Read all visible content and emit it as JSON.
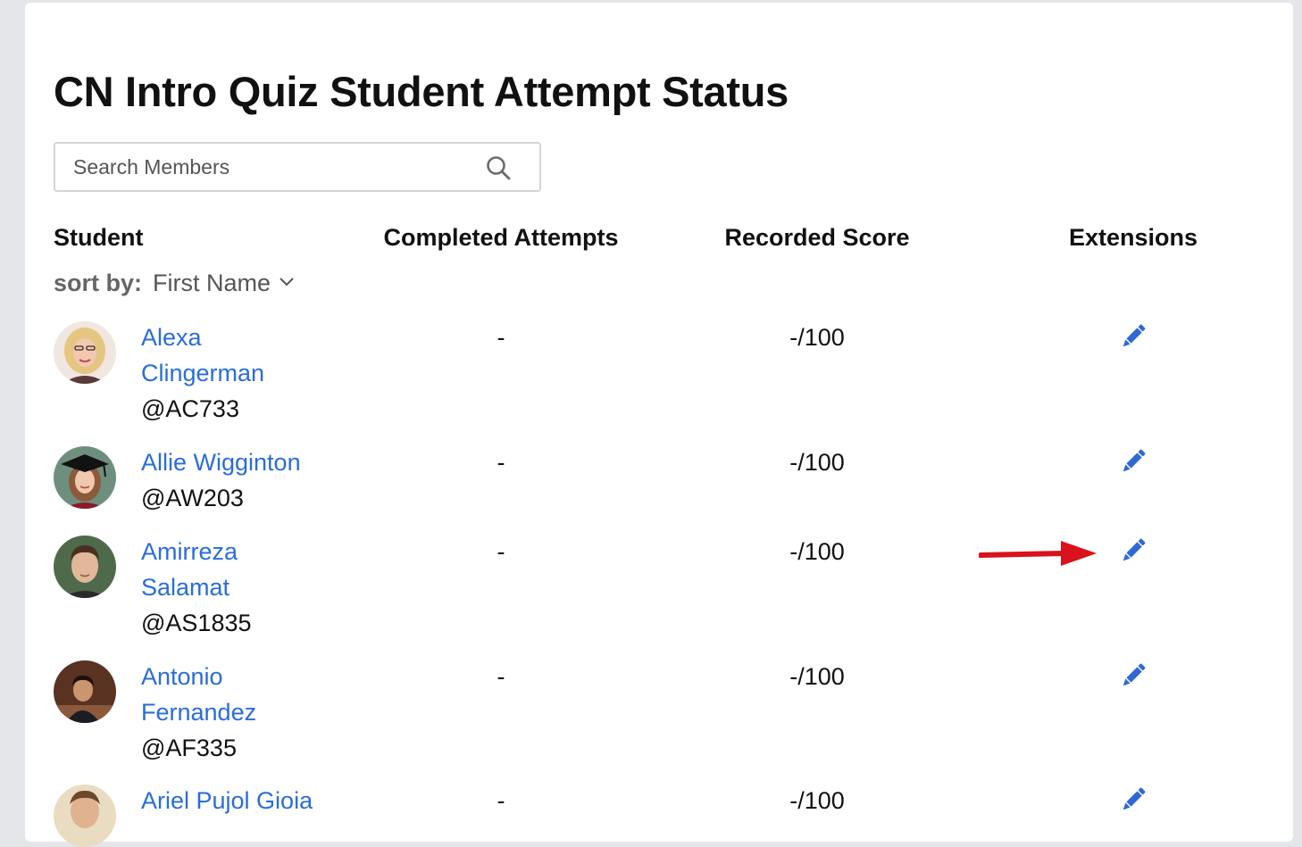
{
  "page": {
    "title": "CN Intro Quiz Student Attempt Status"
  },
  "search": {
    "placeholder": "Search Members",
    "icon": "search-icon"
  },
  "table": {
    "headers": {
      "student": "Student",
      "attempts": "Completed Attempts",
      "score": "Recorded Score",
      "extensions": "Extensions"
    },
    "sort": {
      "label": "sort by:",
      "value": "First Name"
    },
    "rows": [
      {
        "name": "Alexa Clingerman",
        "username": "@AC733",
        "attempts": "-",
        "score": "-/100"
      },
      {
        "name": "Allie Wigginton",
        "username": "@AW203",
        "attempts": "-",
        "score": "-/100"
      },
      {
        "name": "Amirreza Salamat",
        "username": "@AS1835",
        "attempts": "-",
        "score": "-/100"
      },
      {
        "name": "Antonio Fernandez",
        "username": "@AF335",
        "attempts": "-",
        "score": "-/100"
      },
      {
        "name": "Ariel Pujol Gioia",
        "username": "",
        "attempts": "-",
        "score": "-/100"
      }
    ]
  },
  "colors": {
    "link": "#2a6dd9",
    "edit_icon": "#2f68d4",
    "annotation_arrow": "#d9121b",
    "page_background": "#e4e6ea"
  },
  "annotation": {
    "arrow_points_to_row": 3
  }
}
